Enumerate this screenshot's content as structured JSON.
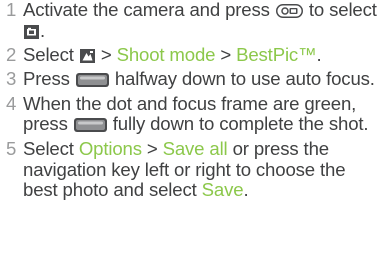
{
  "steps": [
    {
      "number": "1",
      "text_a": "Activate the camera and press",
      "text_b": "to",
      "text_c": "select",
      "text_d": ".",
      "icons": [
        "camera-key-icon",
        "still-camera-icon"
      ]
    },
    {
      "number": "2",
      "text_a": "Select",
      "sep1": " > ",
      "link1": "Shoot mode",
      "sep2": " > ",
      "link2": "BestPic™",
      "text_end": ".",
      "icons": [
        "camera-settings-icon"
      ]
    },
    {
      "number": "3",
      "text_a": "Press",
      "text_b": "halfway down to use auto focus.",
      "icons": [
        "shutter-key-icon"
      ]
    },
    {
      "number": "4",
      "text_a": "When the dot and focus frame are green, press",
      "text_b": "fully down to complete the shot.",
      "icons": [
        "shutter-key-icon"
      ]
    },
    {
      "number": "5",
      "text_a": "Select",
      "link1": "Options",
      "sep1": " > ",
      "link2": "Save all",
      "text_b": "or press the navigation key left or right to choose the best photo and select",
      "link3": "Save",
      "text_end": "."
    }
  ],
  "colors": {
    "text": "#404142",
    "number": "#9a9b9c",
    "link": "#8cc84b",
    "icon": "#4a4b4d"
  }
}
